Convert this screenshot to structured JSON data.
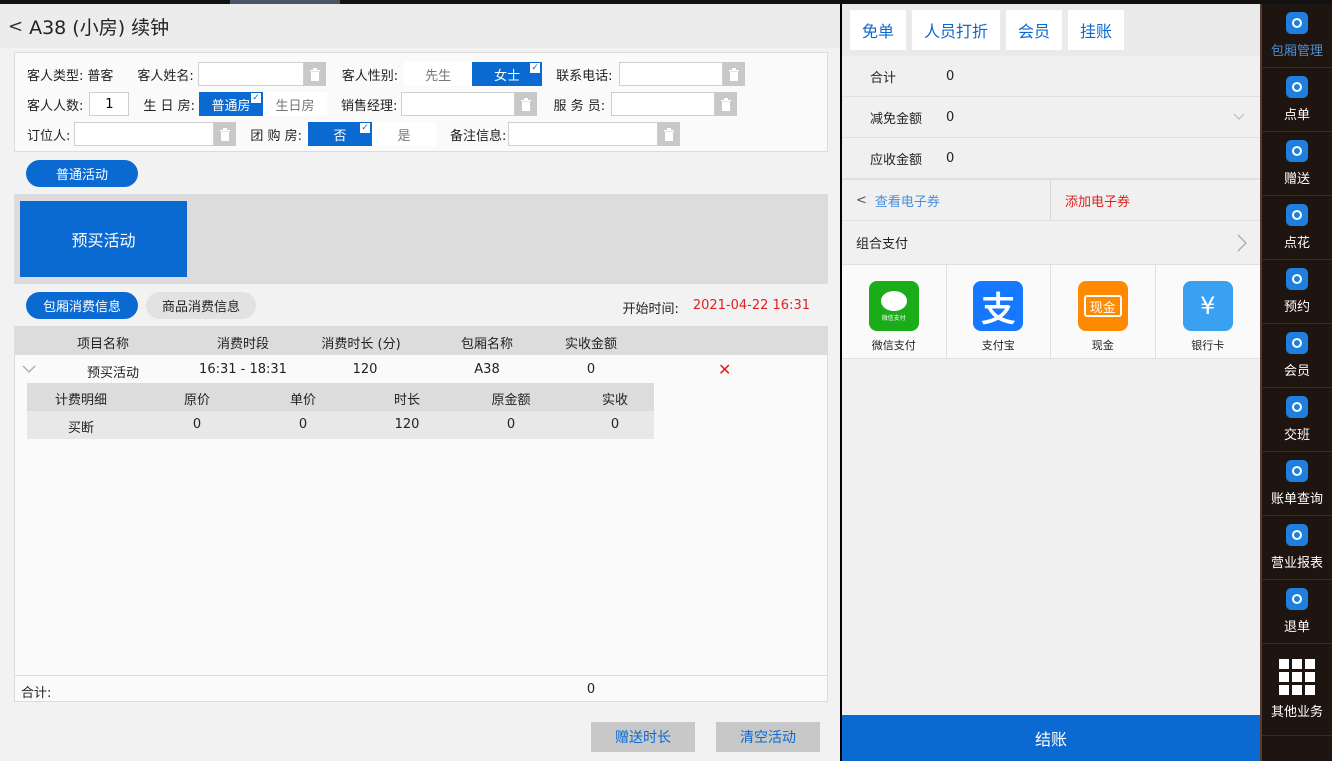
{
  "header": {
    "title": "A38 (小房) 续钟",
    "back_glyph": "<"
  },
  "form": {
    "guest_type_label": "客人类型:",
    "guest_type_value": "普客",
    "guest_name_label": "客人姓名:",
    "guest_gender_label": "客人性别:",
    "gender_options": [
      "先生",
      "女士"
    ],
    "gender_selected": "女士",
    "phone_label": "联系电话:",
    "guest_count_label": "客人人数:",
    "guest_count_value": "1",
    "birthday_room_label": "生 日 房:",
    "room_type_options": [
      "普通房",
      "生日房"
    ],
    "room_type_selected": "普通房",
    "sales_manager_label": "销售经理:",
    "waiter_label": "服 务 员:",
    "booker_label": "订位人:",
    "group_room_label": "团 购 房:",
    "group_options": [
      "否",
      "是"
    ],
    "group_selected": "否",
    "remark_label": "备注信息:"
  },
  "activity": {
    "normal_tab": "普通活动",
    "presale_card": "预买活动"
  },
  "tabs": {
    "room_tab": "包厢消费信息",
    "goods_tab": "商品消费信息"
  },
  "start_time": {
    "label": "开始时间:",
    "value": "2021-04-22 16:31"
  },
  "table": {
    "headers": [
      "项目名称",
      "消费时段",
      "消费时长 (分)",
      "包厢名称",
      "实收金额"
    ],
    "rows": [
      {
        "name": "预买活动",
        "period": "16:31 - 18:31",
        "duration": "120",
        "room": "A38",
        "amount": "0"
      }
    ],
    "sub_headers": [
      "计费明细",
      "原价",
      "单价",
      "时长",
      "原金额",
      "实收"
    ],
    "sub_rows": [
      {
        "detail": "买断",
        "orig_price": "0",
        "unit_price": "0",
        "duration": "120",
        "orig_amount": "0",
        "actual": "0"
      }
    ],
    "total_label": "合计:",
    "total_value": "0",
    "delete_glyph": "✕"
  },
  "buttons": {
    "gift_time": "赠送时长",
    "clear_activity": "清空活动"
  },
  "right": {
    "tabs": [
      "免单",
      "人员打折",
      "会员",
      "挂账"
    ],
    "summary": [
      {
        "label": "合计",
        "value": "0"
      },
      {
        "label": "减免金额",
        "value": "0"
      },
      {
        "label": "应收金额",
        "value": "0"
      }
    ],
    "view_coupon": "查看电子券",
    "add_coupon": "添加电子券",
    "combo_pay": "组合支付",
    "payments": [
      {
        "label": "微信支付",
        "icon": "wechat-pay-icon",
        "color": "#1aad19",
        "glyph": "微信支付"
      },
      {
        "label": "支付宝",
        "icon": "alipay-icon",
        "color": "#1678ff",
        "glyph": "支"
      },
      {
        "label": "现金",
        "icon": "cash-icon",
        "color": "#ff8a00",
        "glyph": "现金"
      },
      {
        "label": "银行卡",
        "icon": "bank-card-icon",
        "color": "#3aa0f0",
        "glyph": "¥"
      }
    ],
    "settle": "结账"
  },
  "sidebar": {
    "items": [
      {
        "label": "包厢管理",
        "icon": "room-manage-icon",
        "active": true
      },
      {
        "label": "点单",
        "icon": "order-icon"
      },
      {
        "label": "赠送",
        "icon": "gift-icon"
      },
      {
        "label": "点花",
        "icon": "flower-icon"
      },
      {
        "label": "预约",
        "icon": "reservation-icon"
      },
      {
        "label": "会员",
        "icon": "member-icon"
      },
      {
        "label": "交班",
        "icon": "shift-icon"
      },
      {
        "label": "账单查询",
        "icon": "bill-query-icon"
      },
      {
        "label": "营业报表",
        "icon": "report-icon"
      },
      {
        "label": "退单",
        "icon": "refund-icon"
      }
    ],
    "more": "其他业务"
  },
  "colors": {
    "primary": "#0a6ad1",
    "danger": "#e02020",
    "link": "#4a8fd8"
  }
}
